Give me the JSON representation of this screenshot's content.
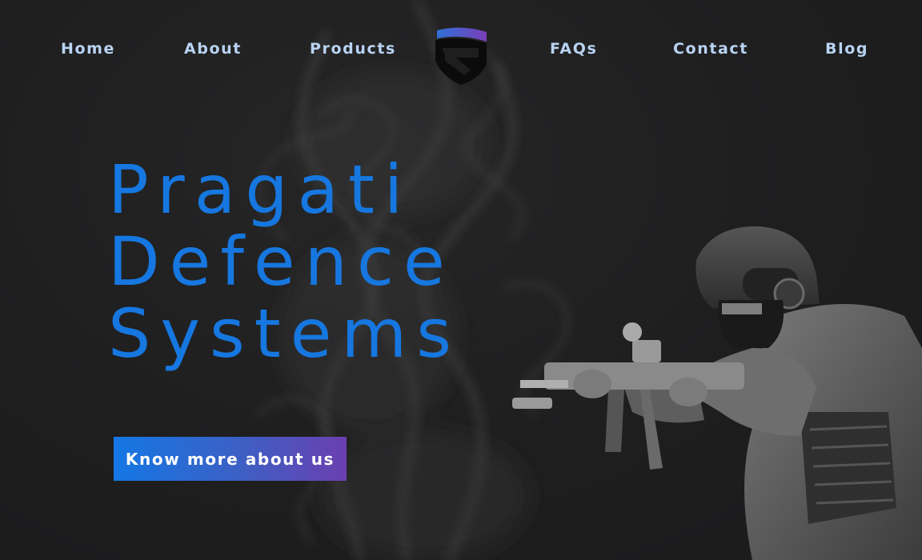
{
  "nav": {
    "items": [
      {
        "label": "Home"
      },
      {
        "label": "About"
      },
      {
        "label": "Products"
      },
      {
        "label": "FAQs"
      },
      {
        "label": "Contact"
      },
      {
        "label": "Blog"
      }
    ]
  },
  "logo": {
    "icon": "shield-s-logo-icon",
    "gradient_start": "#2f6fd8",
    "gradient_end": "#7a3fb8"
  },
  "hero": {
    "title_lines": [
      "Pragati",
      "Defence",
      "Systems"
    ],
    "title_color": "#1677e0",
    "cta_label": "Know more about us",
    "image": "soldier-with-rifle-image"
  },
  "theme": {
    "background": "#1e1e1f",
    "nav_text": "#b9d3f2",
    "cta_gradient": [
      "#1477e4",
      "#6b3fb0"
    ]
  }
}
